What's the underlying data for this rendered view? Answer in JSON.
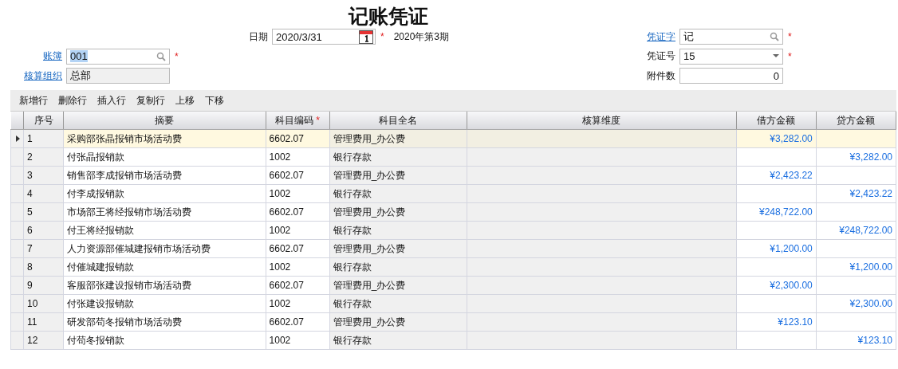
{
  "title": "记账凭证",
  "form": {
    "rows": [
      [
        null,
        {
          "label": "日期",
          "link": false,
          "value": "2020/3/31",
          "kind": "date",
          "required": "*",
          "highlighted": false,
          "note": "2020年第3期"
        },
        {
          "label": "凭证字",
          "link": true,
          "value": "记",
          "kind": "search",
          "required": "*",
          "highlighted": false
        }
      ],
      [
        {
          "label": "账簿",
          "link": true,
          "value": "001",
          "kind": "search",
          "required": "*",
          "highlighted": true
        },
        null,
        {
          "label": "凭证号",
          "link": false,
          "value": "15",
          "kind": "select",
          "required": "*",
          "highlighted": false
        }
      ],
      [
        {
          "label": "核算组织",
          "link": true,
          "value": "总部",
          "kind": "readonly",
          "highlighted": false
        },
        null,
        {
          "label": "附件数",
          "link": false,
          "value": "0",
          "kind": "number",
          "highlighted": false
        }
      ]
    ]
  },
  "toolbar": [
    "新增行",
    "删除行",
    "插入行",
    "复制行",
    "上移",
    "下移"
  ],
  "table": {
    "columns": [
      {
        "label": "序号"
      },
      {
        "label": "摘要"
      },
      {
        "label": "科目编码",
        "required": "*"
      },
      {
        "label": "科目全名"
      },
      {
        "label": "核算维度"
      },
      {
        "label": "借方金额"
      },
      {
        "label": "贷方金额"
      }
    ],
    "rows": [
      {
        "selected": true,
        "seq": "1",
        "summary": "采购部张晶报销市场活动费",
        "code": "6602.07",
        "account": "管理费用_办公费",
        "debit": "¥3,282.00"
      },
      {
        "selected": false,
        "seq": "2",
        "summary": "付张晶报销款",
        "code": "1002",
        "account": "银行存款",
        "credit": "¥3,282.00"
      },
      {
        "selected": false,
        "seq": "3",
        "summary": "销售部李成报销市场活动费",
        "code": "6602.07",
        "account": "管理费用_办公费",
        "debit": "¥2,423.22"
      },
      {
        "selected": false,
        "seq": "4",
        "summary": "付李成报销款",
        "code": "1002",
        "account": "银行存款",
        "credit": "¥2,423.22"
      },
      {
        "selected": false,
        "seq": "5",
        "summary": "市场部王将经报销市场活动费",
        "code": "6602.07",
        "account": "管理费用_办公费",
        "debit": "¥248,722.00"
      },
      {
        "selected": false,
        "seq": "6",
        "summary": "付王将经报销款",
        "code": "1002",
        "account": "银行存款",
        "credit": "¥248,722.00"
      },
      {
        "selected": false,
        "seq": "7",
        "summary": "人力资源部催城建报销市场活动费",
        "code": "6602.07",
        "account": "管理费用_办公费",
        "debit": "¥1,200.00"
      },
      {
        "selected": false,
        "seq": "8",
        "summary": "付催城建报销款",
        "code": "1002",
        "account": "银行存款",
        "credit": "¥1,200.00"
      },
      {
        "selected": false,
        "seq": "9",
        "summary": "客服部张建设报销市场活动费",
        "code": "6602.07",
        "account": "管理费用_办公费",
        "debit": "¥2,300.00"
      },
      {
        "selected": false,
        "seq": "10",
        "summary": "付张建设报销款",
        "code": "1002",
        "account": "银行存款",
        "credit": "¥2,300.00"
      },
      {
        "selected": false,
        "seq": "11",
        "summary": "研发部苟冬报销市场活动费",
        "code": "6602.07",
        "account": "管理费用_办公费",
        "debit": "¥123.10"
      },
      {
        "selected": false,
        "seq": "12",
        "summary": "付苟冬报销款",
        "code": "1002",
        "account": "银行存款",
        "credit": "¥123.10"
      }
    ]
  }
}
